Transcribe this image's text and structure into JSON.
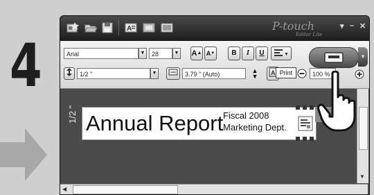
{
  "step": {
    "number": "4"
  },
  "app": {
    "logo": "P-touch",
    "logo_sub": "Editor Lite",
    "window_controls": {
      "dropdown": "▾",
      "minimize": "–",
      "close": "✕"
    }
  },
  "toolbar": {
    "font_name": "Arial",
    "font_size": "28",
    "bold": "B",
    "italic": "I",
    "underline": "U",
    "grow_font": "A",
    "shrink_font": "A",
    "tape_width": "1/2 \"",
    "label_length": "3.79 \" (Auto)",
    "zoom": "100 %"
  },
  "print": {
    "tooltip": "Print"
  },
  "label": {
    "ruler": "1/2 \"",
    "main_text": "Annual Report",
    "line1": "Fiscal 2008",
    "line2": "Marketing Dept.",
    "tail": "A"
  },
  "colors": {
    "titlebar": "#2a2a2a",
    "canvas": "#4b4b4b",
    "label_bg": "#ffffff"
  }
}
